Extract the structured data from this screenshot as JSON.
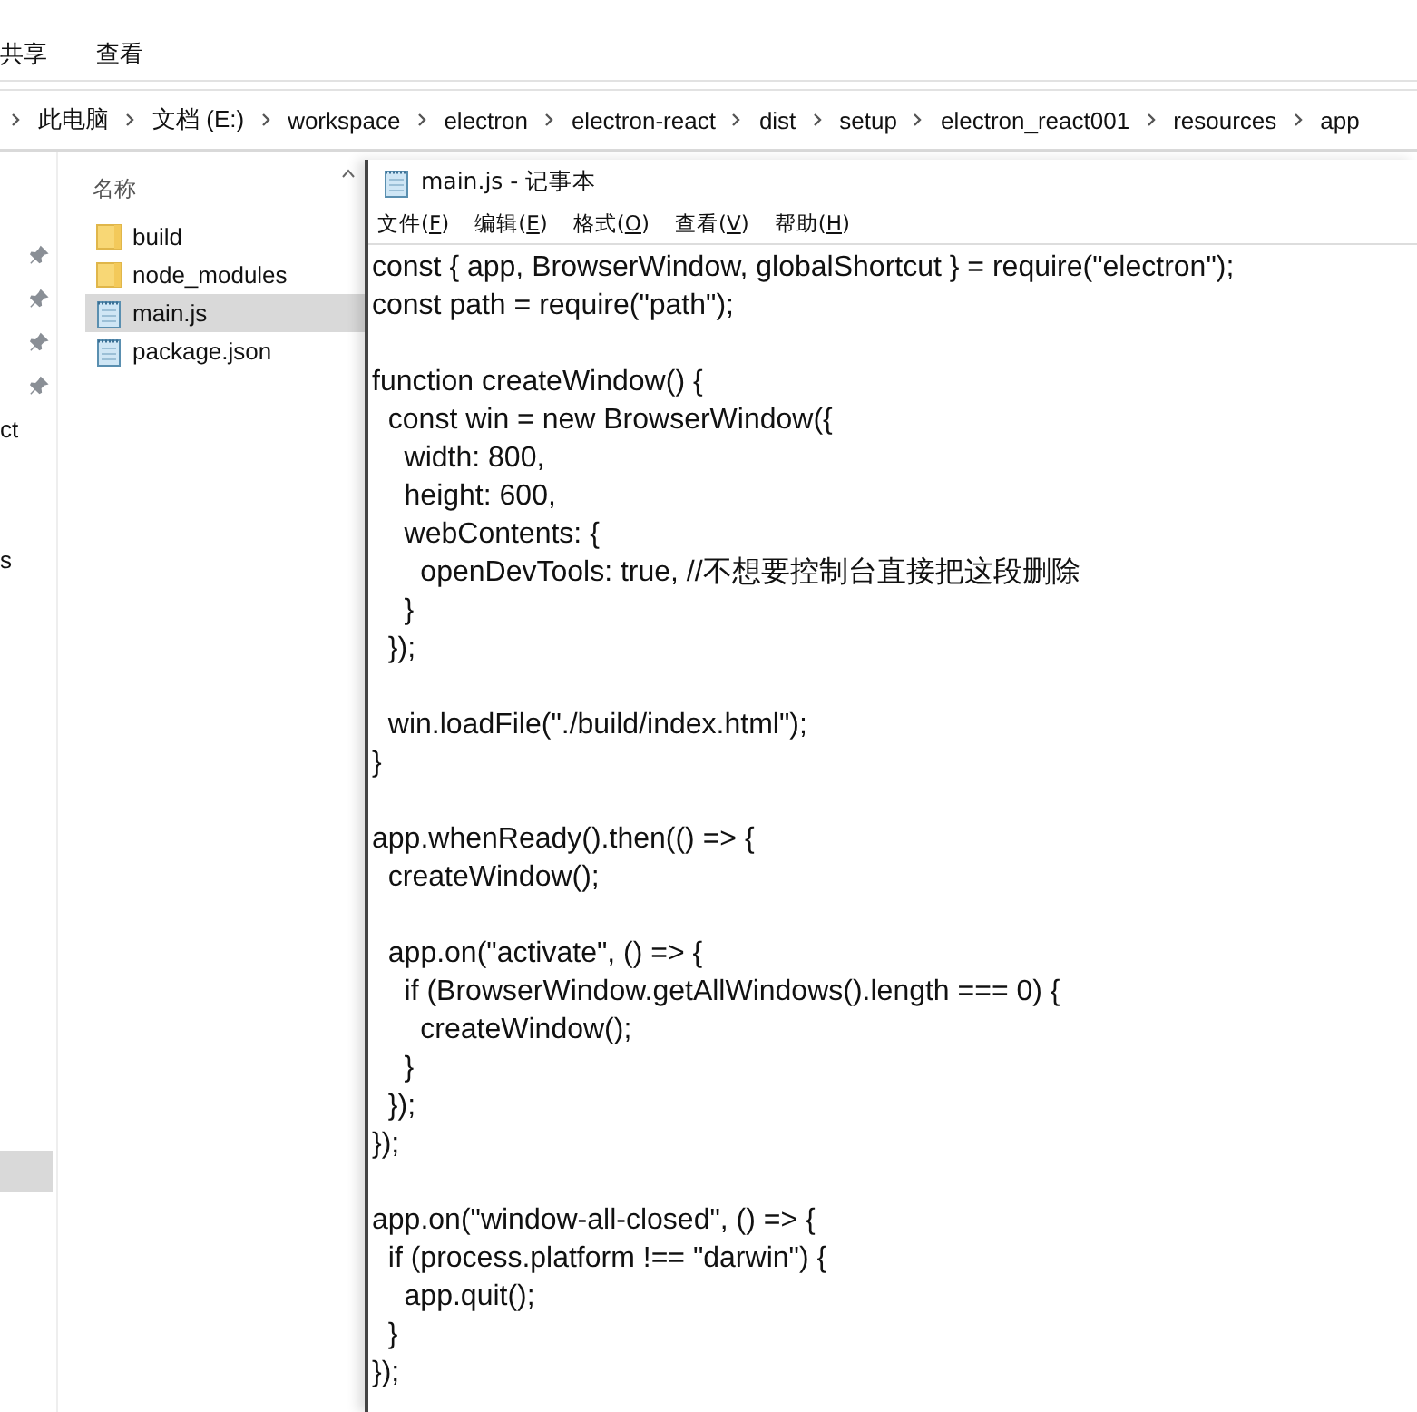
{
  "ribbon": {
    "tabs": [
      {
        "label": "共享",
        "selected": false
      },
      {
        "label": "查看",
        "selected": false
      }
    ]
  },
  "address_bar": {
    "path": [
      "此电脑",
      "文档 (E:)",
      "workspace",
      "electron",
      "electron-react",
      "dist",
      "setup",
      "electron_react001",
      "resources",
      "app"
    ]
  },
  "navigation_pane": {
    "items": [
      {
        "pinned": true
      },
      {
        "pinned": true
      },
      {
        "pinned": true
      },
      {
        "pinned": true
      },
      {
        "label": "ct",
        "pinned": false
      },
      {
        "label": "s",
        "pinned": false
      }
    ]
  },
  "file_list": {
    "column_header": "名称",
    "files": [
      {
        "name": "build",
        "kind": "folder",
        "selected": false
      },
      {
        "name": "node_modules",
        "kind": "folder",
        "selected": false
      },
      {
        "name": "main.js",
        "kind": "file",
        "selected": true
      },
      {
        "name": "package.json",
        "kind": "file",
        "selected": false
      }
    ]
  },
  "notepad": {
    "title": "main.js - 记事本",
    "menu": [
      "文件(F)",
      "编辑(E)",
      "格式(O)",
      "查看(V)",
      "帮助(H)"
    ],
    "text": "const { app, BrowserWindow, globalShortcut } = require(\"electron\");\nconst path = require(\"path\");\n\nfunction createWindow() {\n  const win = new BrowserWindow({\n    width: 800,\n    height: 600,\n    webContents: {\n      openDevTools: true, //不想要控制台直接把这段删除\n    }\n  });\n\n  win.loadFile(\"./build/index.html\");\n}\n\napp.whenReady().then(() => {\n  createWindow();\n\n  app.on(\"activate\", () => {\n    if (BrowserWindow.getAllWindows().length === 0) {\n      createWindow();\n    }\n  });\n});\n\napp.on(\"window-all-closed\", () => {\n  if (process.platform !== \"darwin\") {\n    app.quit();\n  }\n});"
  }
}
